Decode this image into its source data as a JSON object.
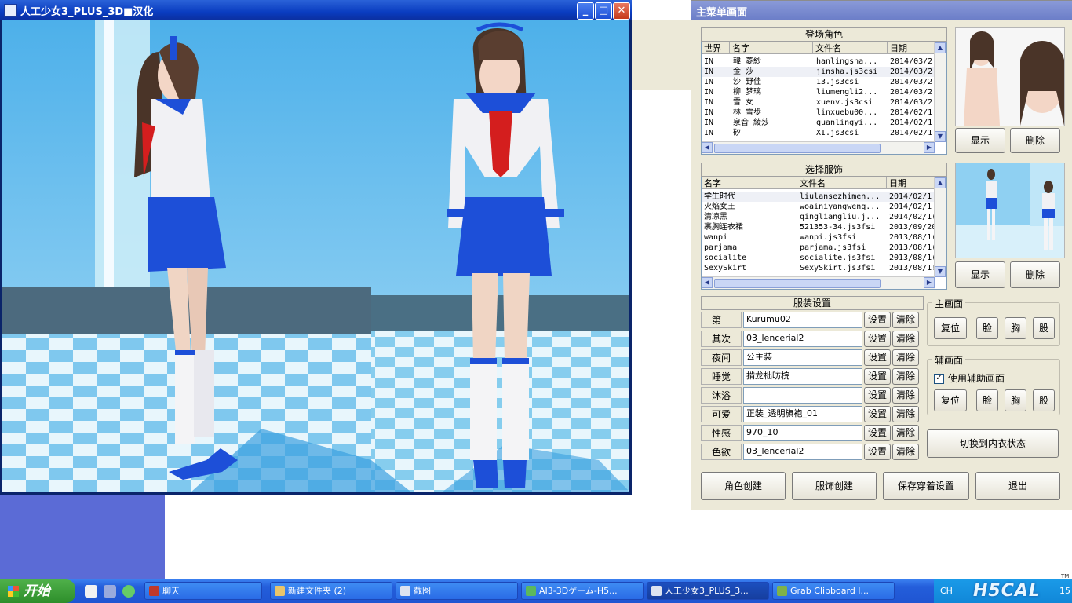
{
  "game_window": {
    "title": "人工少女3_PLUS_3D■汉化",
    "minimize": "_",
    "maximize": "□",
    "close": "✕"
  },
  "panel": {
    "title": "主菜单画面",
    "characters": {
      "header": "登场角色",
      "columns": [
        "世界",
        "名字",
        "文件名",
        "日期"
      ],
      "rows": [
        [
          "IN",
          "韓 菱紗",
          "hanlingsha...",
          "2014/03/2"
        ],
        [
          "IN",
          "金 莎",
          "jinsha.js3csi",
          "2014/03/2"
        ],
        [
          "IN",
          "沙 野佳",
          "13.js3csi",
          "2014/03/2"
        ],
        [
          "IN",
          "柳 梦璃",
          "liumengli2...",
          "2014/03/2"
        ],
        [
          "IN",
          "雪 女",
          "xuenv.js3csi",
          "2014/03/2"
        ],
        [
          "IN",
          "林 雪歩",
          "linxuebu00...",
          "2014/02/1"
        ],
        [
          "IN",
          "泉音 綾莎",
          "quanlingyi...",
          "2014/02/1"
        ],
        [
          "IN",
          "矽",
          "XI.js3csi",
          "2014/02/1"
        ]
      ],
      "show_label": "显示",
      "delete_label": "删除"
    },
    "outfits": {
      "header": "选择服饰",
      "columns": [
        "名字",
        "文件名",
        "日期"
      ],
      "rows": [
        [
          "学生时代",
          "liulansezhimen...",
          "2014/02/1"
        ],
        [
          "火焰女王",
          "woainiyangwenq...",
          "2014/02/1"
        ],
        [
          "清凉黑",
          "qingliangliu.j...",
          "2014/02/1("
        ],
        [
          "裹胸连衣裙",
          "521353-34.js3fsi",
          "2013/09/20"
        ],
        [
          "wanpi",
          "wanpi.js3fsi",
          "2013/08/1("
        ],
        [
          "parjama",
          "parjama.js3fsi",
          "2013/08/1("
        ],
        [
          "socialite",
          "socialite.js3fsi",
          "2013/08/1("
        ],
        [
          "SexySkirt",
          "SexySkirt.js3fsi",
          "2013/08/1!"
        ]
      ],
      "show_label": "显示",
      "delete_label": "删除"
    },
    "costume_settings": {
      "header": "服装设置",
      "set_label": "设置",
      "clear_label": "清除",
      "slots": [
        {
          "label": "第一",
          "value": "Kurumu02"
        },
        {
          "label": "其次",
          "value": "03_lencerial2"
        },
        {
          "label": "夜间",
          "value": "公主装"
        },
        {
          "label": "睡觉",
          "value": "掯龙柮昉梡"
        },
        {
          "label": "沐浴",
          "value": ""
        },
        {
          "label": "可爱",
          "value": "正装_透明旗袍_01"
        },
        {
          "label": "性感",
          "value": "970_10"
        },
        {
          "label": "色欲",
          "value": "03_lencerial2"
        }
      ]
    },
    "main_view": {
      "label": "主画面",
      "buttons": [
        "复位",
        "脸",
        "胸",
        "股"
      ]
    },
    "sub_view": {
      "label": "辅画面",
      "checkbox_label": "使用辅助画面",
      "checked": true,
      "buttons": [
        "复位",
        "脸",
        "胸",
        "股"
      ]
    },
    "switch_underwear": "切换到内衣状态",
    "bottom_buttons": [
      "角色创建",
      "服饰创建",
      "保存穿着设置",
      "退出"
    ]
  },
  "taskbar": {
    "start": "开始",
    "tasks": [
      {
        "label": "聊天",
        "color": "#c0392b"
      },
      {
        "label": "新建文件夹 (2)",
        "color": "#e9c46a"
      },
      {
        "label": "截图",
        "color": "#dde3f0"
      },
      {
        "label": "AI3-3Dゲーム-H5...",
        "color": "#5cb85c"
      },
      {
        "label": "人工少女3_PLUS_3...",
        "color": "#dde3f0"
      },
      {
        "label": "Grab Clipboard I...",
        "color": "#7fb24a"
      }
    ],
    "tray": {
      "lang": "CH",
      "time": "15",
      "watermark": "H5CAL",
      "tm": "TM"
    }
  },
  "colors": {
    "sky": "#7fc8f0",
    "skirt": "#1d4fd8",
    "scarf": "#d41e1e",
    "panel": "#ece9d8"
  }
}
